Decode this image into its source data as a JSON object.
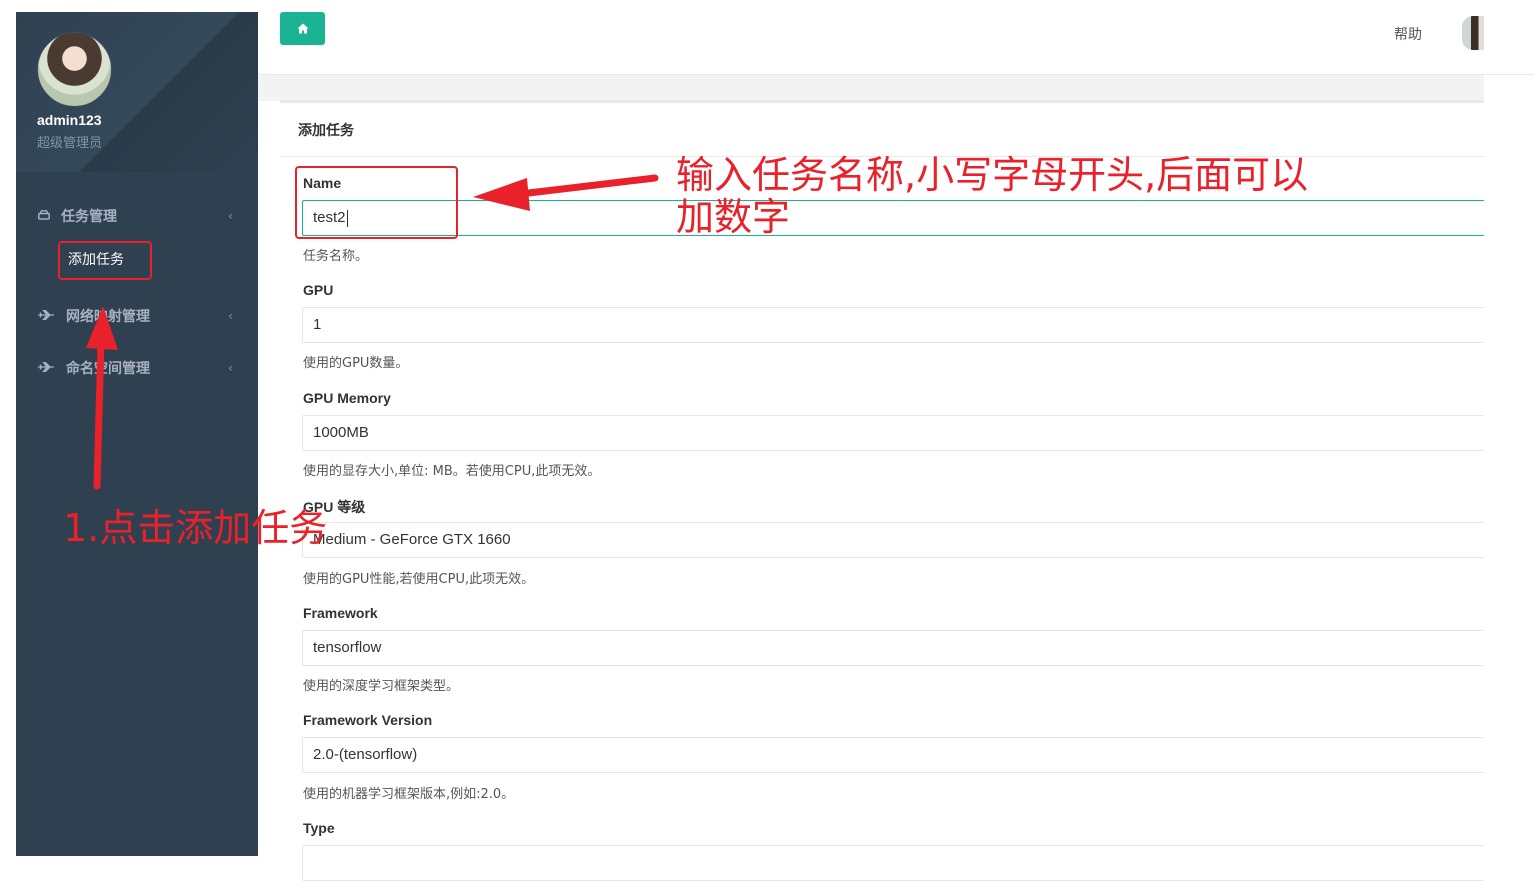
{
  "sidebar": {
    "profile": {
      "username": "admin123",
      "role": "超级管理员"
    },
    "menu": [
      {
        "label": "任务管理",
        "icon": "hdd-icon",
        "caret": "‹"
      },
      {
        "label": "网络映射管理",
        "icon": "plane-icon",
        "caret": "‹"
      },
      {
        "label": "命名空间管理",
        "icon": "plane-icon",
        "caret": "‹"
      }
    ],
    "submenu": {
      "add_task": "添加任务"
    }
  },
  "topbar": {
    "home_icon": "home-icon",
    "help": "帮助"
  },
  "panel": {
    "title": "添加任务"
  },
  "form": {
    "name": {
      "label": "Name",
      "value": "test2",
      "help": "任务名称。"
    },
    "gpu": {
      "label": "GPU",
      "value": "1",
      "help": "使用的GPU数量。"
    },
    "gpu_memory": {
      "label": "GPU Memory",
      "value": "1000MB",
      "help": "使用的显存大小,单位: MB。若使用CPU,此项无效。"
    },
    "gpu_level": {
      "label": "GPU 等级",
      "value": "Medium - GeForce GTX 1660",
      "help": "使用的GPU性能,若使用CPU,此项无效。"
    },
    "framework": {
      "label": "Framework",
      "value": "tensorflow",
      "help": "使用的深度学习框架类型。"
    },
    "framework_version": {
      "label": "Framework Version",
      "value": "2.0-(tensorflow)",
      "help": "使用的机器学习框架版本,例如:2.0。"
    },
    "type": {
      "label": "Type"
    }
  },
  "annotations": {
    "step1": "1.点击添加任务",
    "name_hint_line1": "输入任务名称,小写字母开头,后面可以",
    "name_hint_line2": "加数字",
    "color": "#e8212a"
  },
  "colors": {
    "sidebar": "#2f4050",
    "accent": "#1ab394"
  }
}
